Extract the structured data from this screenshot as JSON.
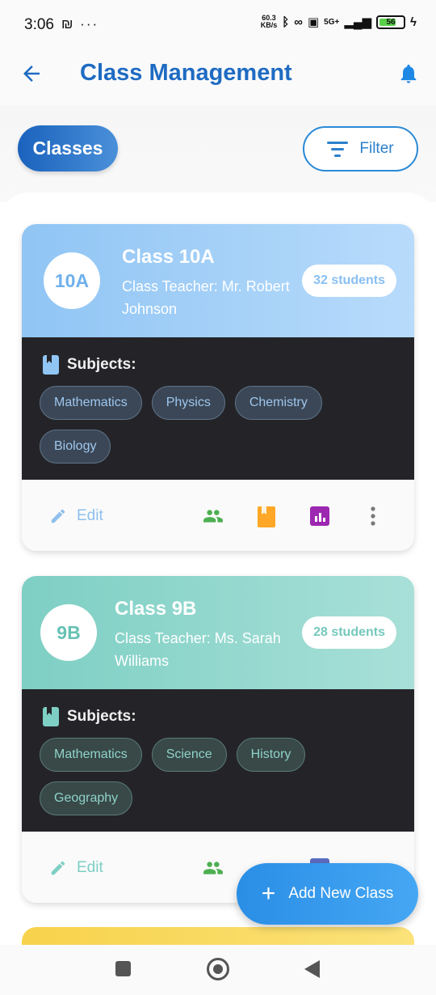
{
  "status_bar": {
    "time": "3:06",
    "left_icons": "₪ ···",
    "speed_value": "60.3",
    "speed_unit": "KB/s",
    "network": "5G+",
    "battery": "56"
  },
  "header": {
    "title": "Class Management",
    "back_icon": "arrow-left-icon",
    "bell_icon": "bell-icon"
  },
  "controls": {
    "classes_label": "Classes",
    "filter_label": "Filter"
  },
  "classes": [
    {
      "code": "10A",
      "name": "Class 10A",
      "teacher": "Class Teacher: Mr. Robert Johnson",
      "students": "32 students",
      "subjects_label": "Subjects:",
      "subjects": [
        "Mathematics",
        "Physics",
        "Chemistry",
        "Biology"
      ],
      "edit_label": "Edit",
      "accent": "#90c5f4"
    },
    {
      "code": "9B",
      "name": "Class 9B",
      "teacher": "Class Teacher: Ms. Sarah Williams",
      "students": "28 students",
      "subjects_label": "Subjects:",
      "subjects": [
        "Mathematics",
        "Science",
        "History",
        "Geography"
      ],
      "edit_label": "Edit",
      "accent": "#7ecfc4"
    }
  ],
  "fab": {
    "label": "Add New Class"
  },
  "colors": {
    "primary": "#1e6bc2",
    "fab": "#2a8ee6",
    "people_icon": "#4caf50",
    "book_icon": "#ffa726",
    "report_icon": "#9c27b0",
    "class_3_accent": "#f7d24b"
  }
}
